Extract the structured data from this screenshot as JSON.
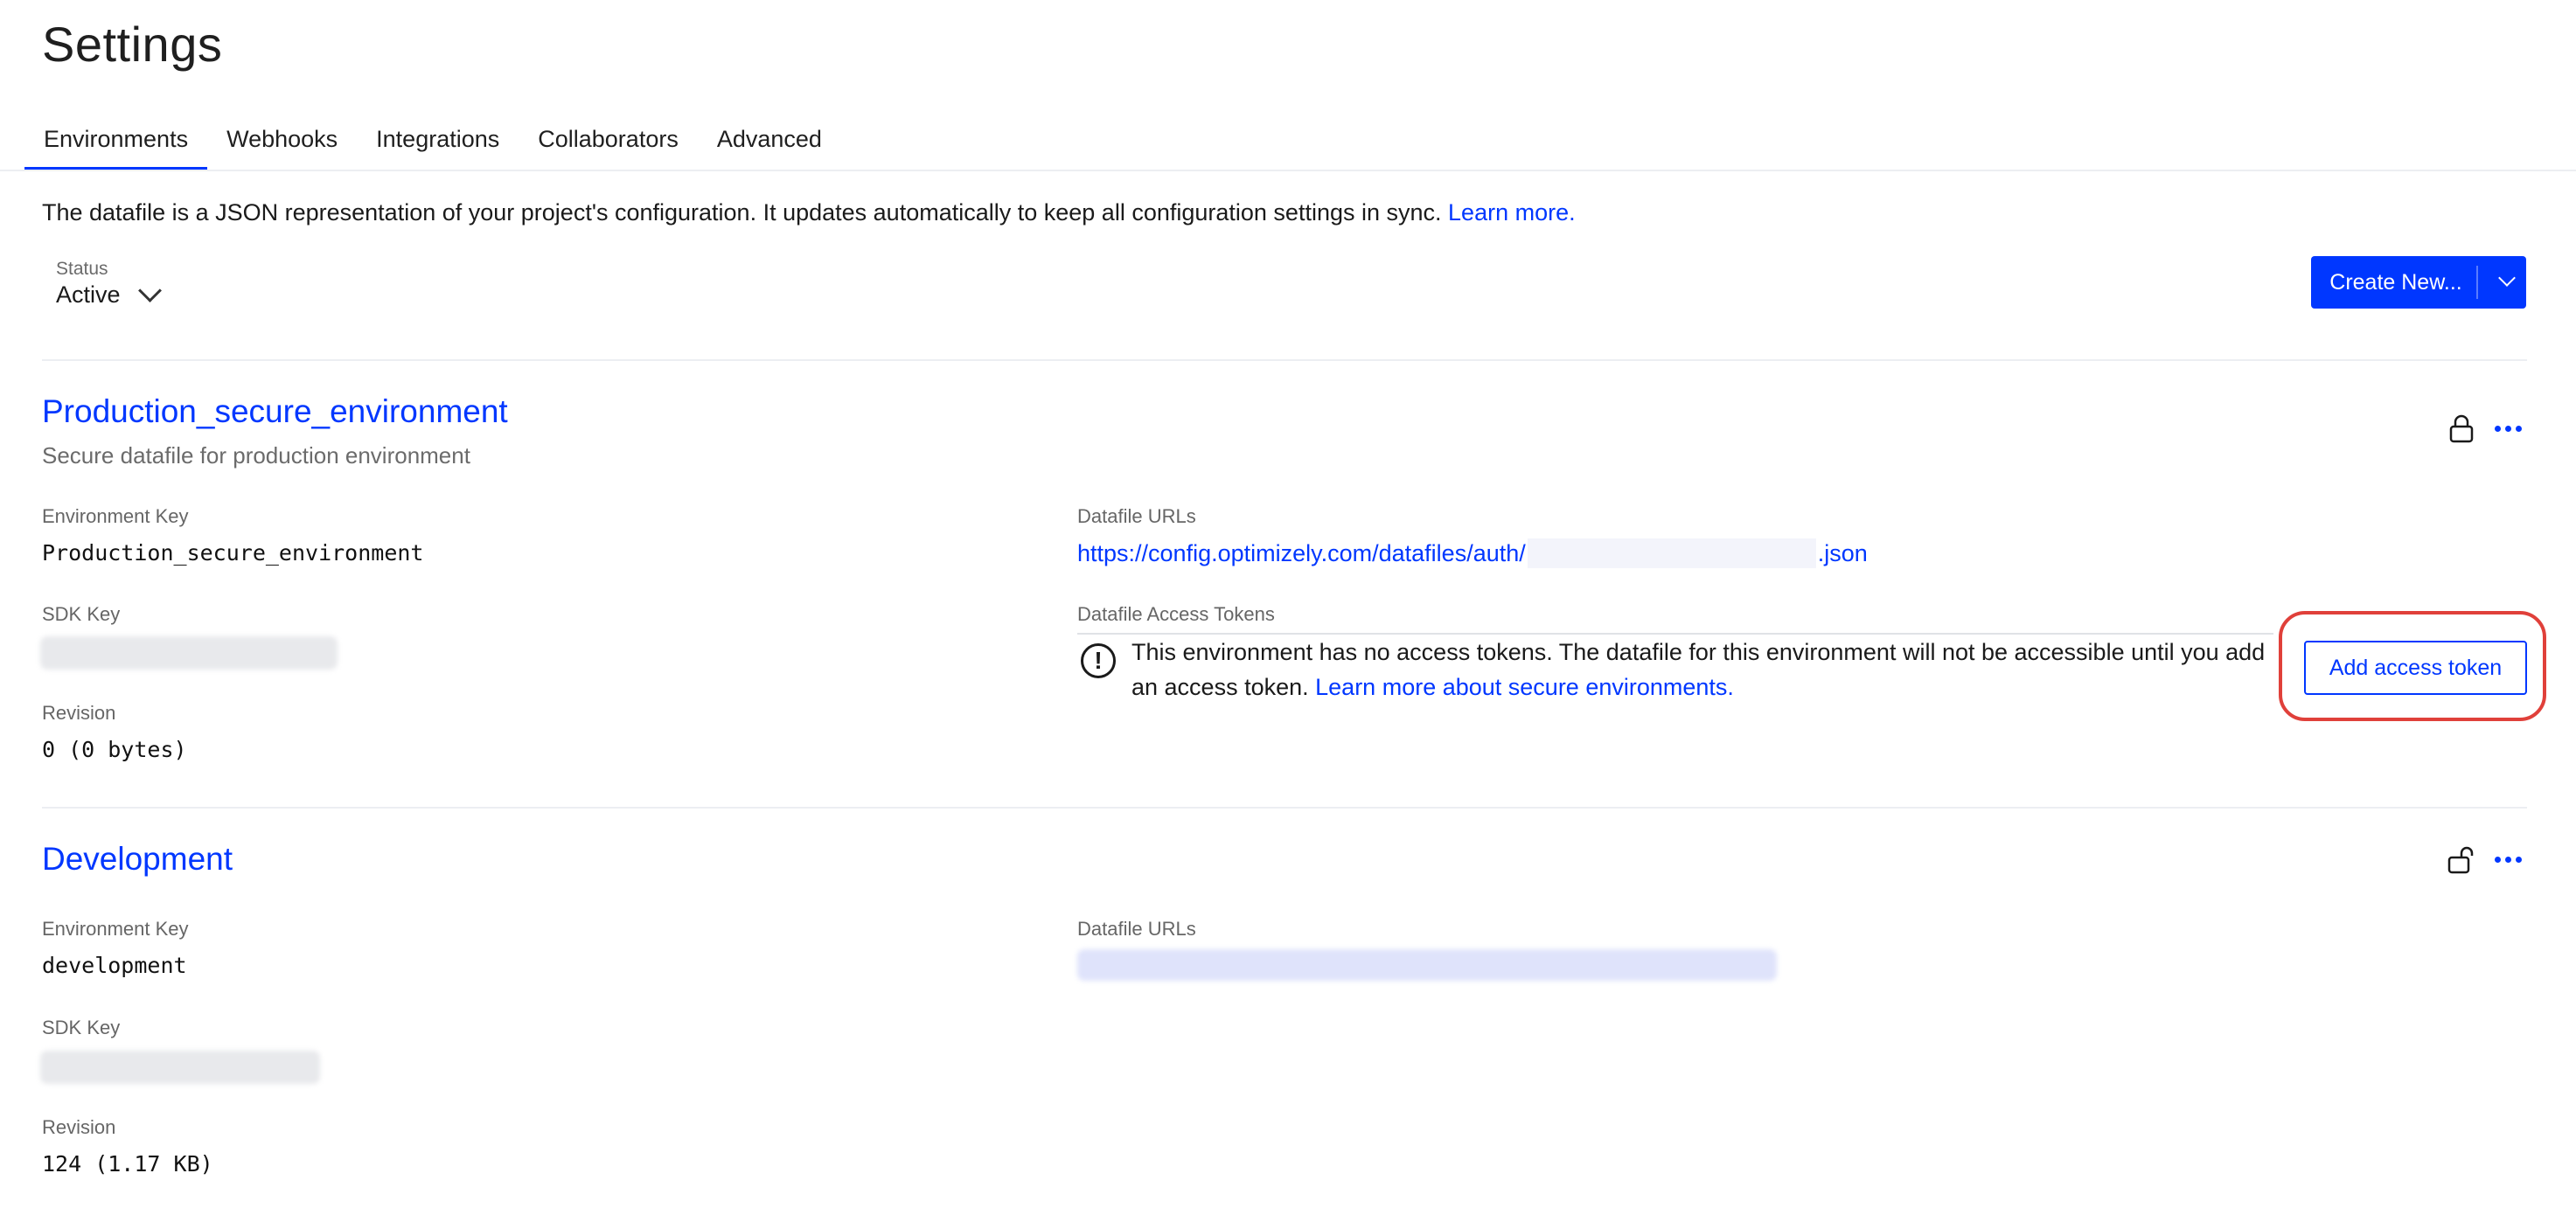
{
  "page": {
    "title": "Settings"
  },
  "tabs": [
    {
      "label": "Environments",
      "active": true
    },
    {
      "label": "Webhooks",
      "active": false
    },
    {
      "label": "Integrations",
      "active": false
    },
    {
      "label": "Collaborators",
      "active": false
    },
    {
      "label": "Advanced",
      "active": false
    }
  ],
  "intro": {
    "text": "The datafile is a JSON representation of your project's configuration. It updates automatically to keep all configuration settings in sync.",
    "link": "Learn more."
  },
  "status_filter": {
    "label": "Status",
    "value": "Active",
    "icon": "chevron-down-icon"
  },
  "create_button": {
    "label": "Create New...",
    "icon": "chevron-down-icon"
  },
  "colors": {
    "accent": "#0037ff",
    "highlight": "#e0403a",
    "muted_text": "#6b6b6b"
  },
  "environments": [
    {
      "name": "Production_secure_environment",
      "description": "Secure datafile for production environment",
      "lock_icon": "lock-closed-icon",
      "menu_icon": "more-horizontal-icon",
      "environment_key_label": "Environment Key",
      "environment_key": "Production_secure_environment",
      "sdk_key_label": "SDK Key",
      "revision_label": "Revision",
      "revision": "0 (0 bytes)",
      "datafile_urls_label": "Datafile URLs",
      "datafile_url_prefix": "https://config.optimizely.com/datafiles/auth/",
      "datafile_url_suffix": ".json",
      "access_tokens_label": "Datafile Access Tokens",
      "warning_icon": "exclamation-circle-icon",
      "warning_text": "This environment has no access tokens. The datafile for this environment will not be accessible until you add an access token.",
      "warning_link": "Learn more about secure environments.",
      "add_token_label": "Add access token"
    },
    {
      "name": "Development",
      "lock_icon": "lock-open-icon",
      "menu_icon": "more-horizontal-icon",
      "environment_key_label": "Environment Key",
      "environment_key": "development",
      "sdk_key_label": "SDK Key",
      "revision_label": "Revision",
      "revision": "124 (1.17 KB)",
      "datafile_urls_label": "Datafile URLs"
    }
  ]
}
